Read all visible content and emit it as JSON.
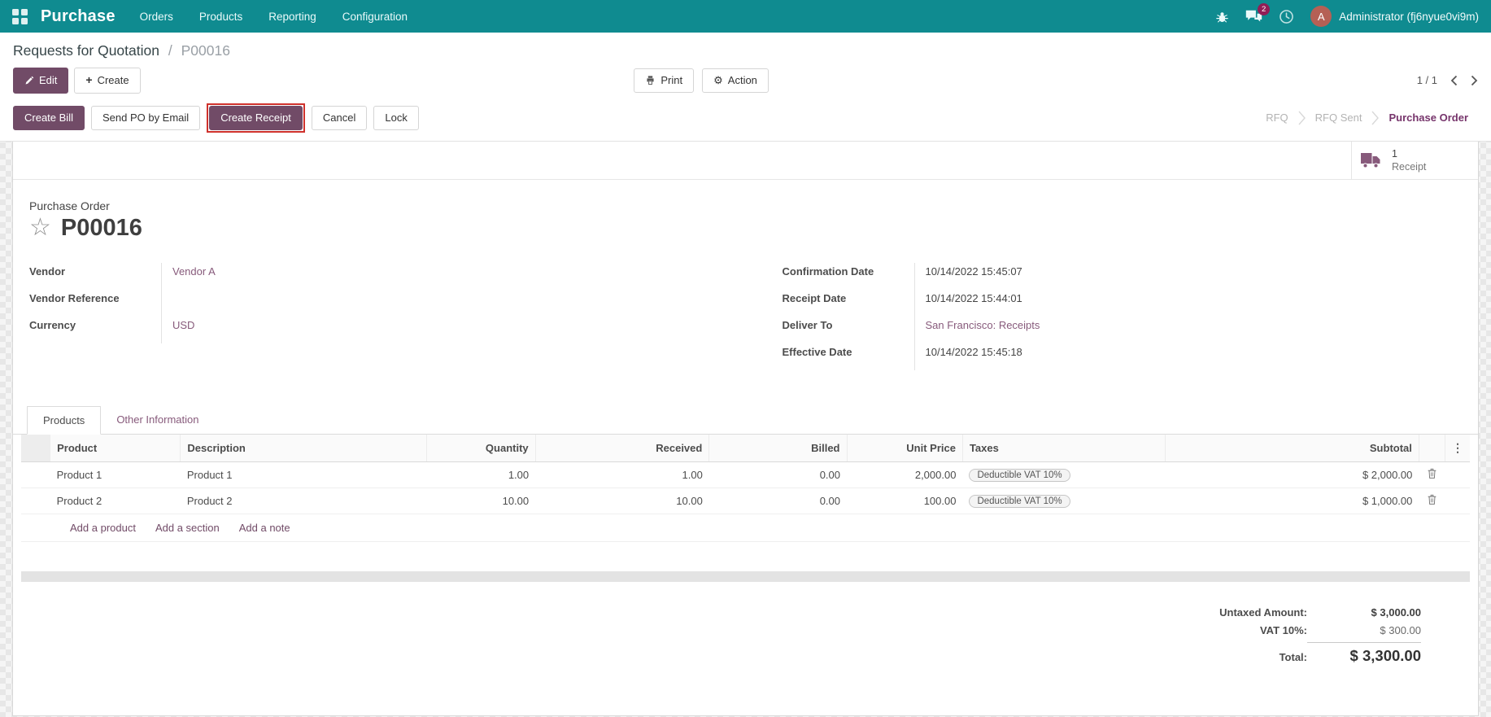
{
  "topbar": {
    "app_name": "Purchase",
    "menus": [
      {
        "label": "Orders"
      },
      {
        "label": "Products"
      },
      {
        "label": "Reporting"
      },
      {
        "label": "Configuration"
      }
    ],
    "message_badge": "2",
    "avatar_initial": "A",
    "user": "Administrator (fj6nyue0vi9m)"
  },
  "control_panel": {
    "breadcrumb": {
      "parent": "Requests for Quotation",
      "separator": "/",
      "current": "P00016"
    },
    "edit_label": "Edit",
    "create_label": "Create",
    "print_label": "Print",
    "action_label": "Action",
    "pager_value": "1 / 1"
  },
  "statusbar": {
    "buttons": [
      {
        "label": "Create Bill"
      },
      {
        "label": "Send PO by Email"
      },
      {
        "label": "Create Receipt"
      },
      {
        "label": "Cancel"
      },
      {
        "label": "Lock"
      }
    ],
    "states": [
      {
        "label": "RFQ"
      },
      {
        "label": "RFQ Sent"
      },
      {
        "label": "Purchase Order"
      }
    ]
  },
  "smart_button": {
    "count": "1",
    "label": "Receipt"
  },
  "sheet": {
    "doc_type": "Purchase Order",
    "doc_name": "P00016",
    "left_fields": [
      {
        "label": "Vendor",
        "value": "Vendor A"
      },
      {
        "label": "Vendor Reference",
        "value": ""
      },
      {
        "label": "Currency",
        "value": "USD"
      }
    ],
    "right_fields": [
      {
        "label": "Confirmation Date",
        "value": "10/14/2022 15:45:07"
      },
      {
        "label": "Receipt Date",
        "value": "10/14/2022 15:44:01"
      },
      {
        "label": "Deliver To",
        "value": "San Francisco: Receipts"
      },
      {
        "label": "Effective Date",
        "value": "10/14/2022 15:45:18"
      }
    ],
    "tabs": [
      {
        "label": "Products"
      },
      {
        "label": "Other Information"
      }
    ],
    "table": {
      "headers": [
        "Product",
        "Description",
        "Quantity",
        "Received",
        "Billed",
        "Unit Price",
        "Taxes",
        "Subtotal"
      ],
      "rows": [
        {
          "product": "Product 1",
          "description": "Product 1",
          "quantity": "1.00",
          "received": "1.00",
          "billed": "0.00",
          "unit_price": "2,000.00",
          "taxes": "Deductible VAT 10%",
          "subtotal": "$ 2,000.00"
        },
        {
          "product": "Product 2",
          "description": "Product 2",
          "quantity": "10.00",
          "received": "10.00",
          "billed": "0.00",
          "unit_price": "100.00",
          "taxes": "Deductible VAT 10%",
          "subtotal": "$ 1,000.00"
        }
      ],
      "footer_links": [
        {
          "label": "Add a product"
        },
        {
          "label": "Add a section"
        },
        {
          "label": "Add a note"
        }
      ]
    },
    "totals": [
      {
        "label": "Untaxed Amount:",
        "value": "$ 3,000.00"
      },
      {
        "label": "VAT 10%:",
        "value": "$ 300.00"
      },
      {
        "label": "Total:",
        "value": "$ 3,300.00"
      }
    ]
  },
  "colors": {
    "topbar_bg": "#0f8b90",
    "primary_purple": "#714B67",
    "link_purple": "#875A7B",
    "highlight_red": "#cf312c",
    "active_state": "#76346b",
    "badge": "#921d56",
    "avatar_bg": "#b56055"
  }
}
